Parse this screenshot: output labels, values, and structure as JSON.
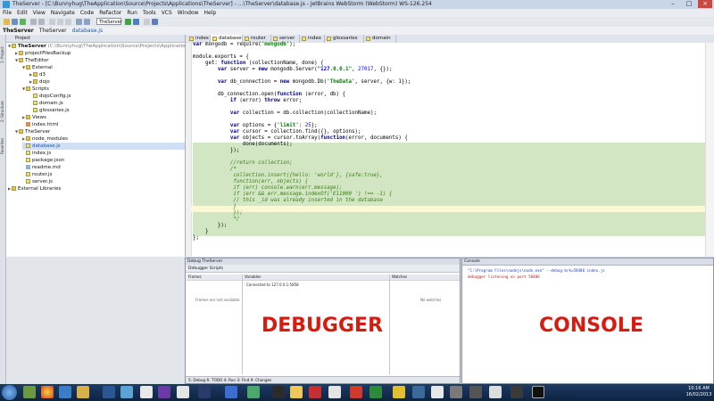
{
  "window": {
    "title": "TheServer - [C:\\Bunnyhug\\TheApplication\\Source\\Projects\\Applications\\TheServer] - ...\\TheServer\\database.js - JetBrains WebStorm (WebStorm) WS-126.254"
  },
  "menu": [
    "File",
    "Edit",
    "View",
    "Navigate",
    "Code",
    "Refactor",
    "Run",
    "Tools",
    "VCS",
    "Window",
    "Help"
  ],
  "toolbar": {
    "run_config": "TheServer"
  },
  "breadcrumb": [
    "TheServer",
    "TheServer",
    "database.js"
  ],
  "left_strip": [
    "1: Project",
    "2: Structure",
    "Favorites"
  ],
  "project": {
    "header": "Project",
    "items": [
      {
        "label": "TheServer",
        "suffix": " (C:\\Bunnyhug\\TheApplication\\Source\\Projects\\Applications\\TheServer)",
        "type": "folder",
        "depth": 0,
        "expanded": true
      },
      {
        "label": "projectFilesBackup",
        "type": "folder",
        "depth": 1
      },
      {
        "label": "TheEditor",
        "type": "folder",
        "depth": 1,
        "expanded": true
      },
      {
        "label": "External",
        "type": "folder",
        "depth": 2,
        "expanded": true
      },
      {
        "label": "d3",
        "type": "folder",
        "depth": 3
      },
      {
        "label": "dojo",
        "type": "folder",
        "depth": 3
      },
      {
        "label": "Scripts",
        "type": "folder",
        "depth": 2,
        "expanded": true
      },
      {
        "label": "dojoConfig.js",
        "type": "js",
        "depth": 3
      },
      {
        "label": "domain.js",
        "type": "js",
        "depth": 3
      },
      {
        "label": "glossaries.js",
        "type": "js",
        "depth": 3
      },
      {
        "label": "Views",
        "type": "folder",
        "depth": 2
      },
      {
        "label": "index.html",
        "type": "html",
        "depth": 2
      },
      {
        "label": "TheServer",
        "type": "folder",
        "depth": 1,
        "expanded": true
      },
      {
        "label": "node_modules",
        "type": "folder",
        "depth": 2
      },
      {
        "label": "database.js",
        "type": "js",
        "depth": 2,
        "selected": true
      },
      {
        "label": "index.js",
        "type": "js",
        "depth": 2
      },
      {
        "label": "package.json",
        "type": "json",
        "depth": 2
      },
      {
        "label": "readme.md",
        "type": "md",
        "depth": 2
      },
      {
        "label": "router.js",
        "type": "js",
        "depth": 2
      },
      {
        "label": "server.js",
        "type": "js",
        "depth": 2
      },
      {
        "label": "External Libraries",
        "type": "lib",
        "depth": 0
      }
    ]
  },
  "tabs": [
    {
      "label": "index"
    },
    {
      "label": "database",
      "active": true
    },
    {
      "label": "router"
    },
    {
      "label": "server"
    },
    {
      "label": "index"
    },
    {
      "label": "glossaries"
    },
    {
      "label": "domain"
    }
  ],
  "code_lines": [
    "var mongodb = require('mongodb');",
    "",
    "module.exports = {",
    "    get: function (collectionName, done) {",
    "        var server = new mongodb.Server(\"127.0.0.1\", 27017, {});",
    "",
    "        var db_connection = new mongodb.Db('TheData', server, {w: 1});",
    "",
    "        db_connection.open(function (error, db) {",
    "            if (error) throw error;",
    "",
    "            var collection = db.collection(collectionName);",
    "",
    "            var options = {'limit': 25};",
    "            var cursor = collection.find({}, options);",
    "            var objects = cursor.toArray(function(error, documents) {",
    "                done(documents);",
    "            });",
    "",
    "            //return collection;",
    "            /*",
    "             collection.insert({hello: 'world'}, {safe:true},",
    "             function(err, objects) {",
    "             if (err) console.warn(err.message);",
    "             if (err && err.message.indexOf('E11000 ') !== -1) {",
    "             // this _id was already inserted in the database",
    "             }",
    "             });",
    "             */",
    "        });",
    "    }",
    "};"
  ],
  "debugger": {
    "header": "Debug TheServer",
    "toolbar_label": "Debugger  Scripts",
    "frames_header": "Frames",
    "frames_empty": "Frames are not available",
    "variables_header": "Variables",
    "variables_item": "Connected to 127.0.0.1:5858",
    "watches_header": "Watches",
    "watches_empty": "No watches",
    "footer": "5: Debug   6: TODO   4: Run   3: Find   9: Changes",
    "annotation": "DEBUGGER"
  },
  "console": {
    "header": "Console",
    "lines": [
      "\"C:\\Program Files\\nodejs\\node.exe\" --debug-brk=58486 index.js",
      "debugger listening on port 58486"
    ],
    "annotation": "CONSOLE"
  },
  "taskbar": {
    "time": "10:16 AM",
    "date": "16/02/2013"
  },
  "colors": {
    "annotation_red": "#d81b10",
    "comment_block_bg": "#d3e6c4",
    "string_green": "#077a07",
    "keyword_blue": "#00008b"
  }
}
